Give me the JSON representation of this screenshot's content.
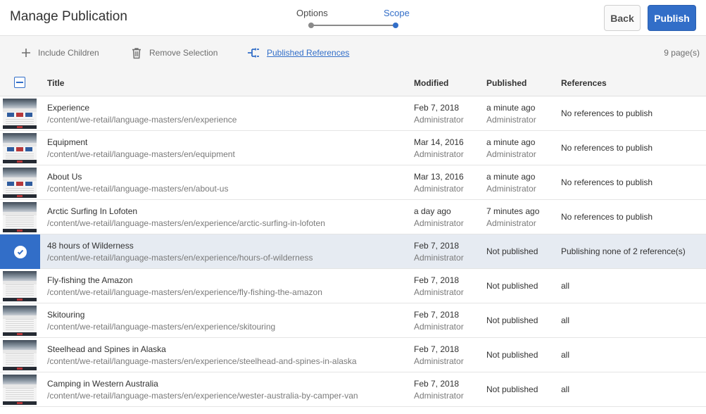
{
  "header": {
    "title": "Manage Publication",
    "steps": [
      {
        "label": "Options",
        "state": "done"
      },
      {
        "label": "Scope",
        "state": "current"
      }
    ],
    "back_label": "Back",
    "publish_label": "Publish"
  },
  "toolbar": {
    "include_children": {
      "label": "Include Children",
      "icon": "plus-icon"
    },
    "remove_selection": {
      "label": "Remove Selection",
      "icon": "trash-icon"
    },
    "published_references": {
      "label": "Published References",
      "icon": "references-icon"
    },
    "page_count": "9 page(s)"
  },
  "table": {
    "columns": [
      "Title",
      "Modified",
      "Published",
      "References"
    ],
    "rows": [
      {
        "title": "Experience",
        "path": "/content/we-retail/language-masters/en/experience",
        "modified": "Feb 7, 2018",
        "modified_by": "Administrator",
        "published": "a minute ago",
        "published_by": "Administrator",
        "references": "No references to publish",
        "selected": false
      },
      {
        "title": "Equipment",
        "path": "/content/we-retail/language-masters/en/equipment",
        "modified": "Mar 14, 2016",
        "modified_by": "Administrator",
        "published": "a minute ago",
        "published_by": "Administrator",
        "references": "No references to publish",
        "selected": false
      },
      {
        "title": "About Us",
        "path": "/content/we-retail/language-masters/en/about-us",
        "modified": "Mar 13, 2016",
        "modified_by": "Administrator",
        "published": "a minute ago",
        "published_by": "Administrator",
        "references": "No references to publish",
        "selected": false
      },
      {
        "title": "Arctic Surfing In Lofoten",
        "path": "/content/we-retail/language-masters/en/experience/arctic-surfing-in-lofoten",
        "modified": "a day ago",
        "modified_by": "Administrator",
        "published": "7 minutes ago",
        "published_by": "Administrator",
        "references": "No references to publish",
        "selected": false
      },
      {
        "title": "48 hours of Wilderness",
        "path": "/content/we-retail/language-masters/en/experience/hours-of-wilderness",
        "modified": "Feb 7, 2018",
        "modified_by": "Administrator",
        "published": "Not published",
        "published_by": "",
        "references": "Publishing none of 2 reference(s)",
        "selected": true
      },
      {
        "title": "Fly-fishing the Amazon",
        "path": "/content/we-retail/language-masters/en/experience/fly-fishing-the-amazon",
        "modified": "Feb 7, 2018",
        "modified_by": "Administrator",
        "published": "Not published",
        "published_by": "",
        "references": "all",
        "selected": false
      },
      {
        "title": "Skitouring",
        "path": "/content/we-retail/language-masters/en/experience/skitouring",
        "modified": "Feb 7, 2018",
        "modified_by": "Administrator",
        "published": "Not published",
        "published_by": "",
        "references": "all",
        "selected": false
      },
      {
        "title": "Steelhead and Spines in Alaska",
        "path": "/content/we-retail/language-masters/en/experience/steelhead-and-spines-in-alaska",
        "modified": "Feb 7, 2018",
        "modified_by": "Administrator",
        "published": "Not published",
        "published_by": "",
        "references": "all",
        "selected": false
      },
      {
        "title": "Camping in Western Australia",
        "path": "/content/we-retail/language-masters/en/experience/wester-australia-by-camper-van",
        "modified": "Feb 7, 2018",
        "modified_by": "Administrator",
        "published": "Not published",
        "published_by": "",
        "references": "all",
        "selected": false
      }
    ]
  },
  "colors": {
    "accent": "#326ec8",
    "selected_row": "#e6ebf2",
    "toolbar_bg": "#f5f5f5"
  }
}
